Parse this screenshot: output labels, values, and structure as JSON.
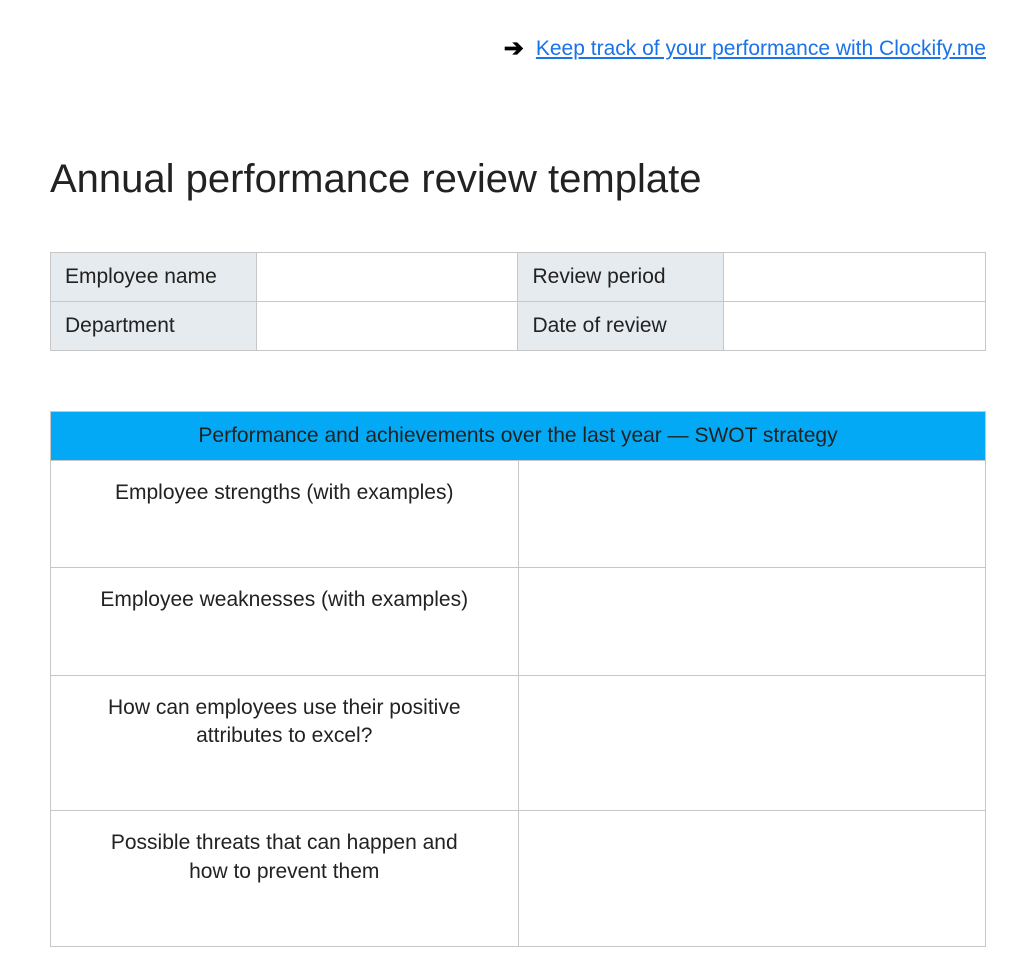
{
  "header": {
    "link_text": "Keep track of your performance with Clockify.me"
  },
  "title": "Annual performance review template",
  "info": {
    "rows": [
      {
        "label_left": "Employee name",
        "value_left": "",
        "label_right": "Review period",
        "value_right": ""
      },
      {
        "label_left": "Department",
        "value_left": "",
        "label_right": "Date of review",
        "value_right": ""
      }
    ]
  },
  "swot": {
    "header": "Performance and achievements over the last year — SWOT strategy",
    "rows": [
      {
        "label": "Employee strengths (with examples)",
        "value": ""
      },
      {
        "label": "Employee weaknesses (with examples)",
        "value": ""
      },
      {
        "label": "How can employees use their positive attributes to excel?",
        "value": ""
      },
      {
        "label": "Possible threats that can happen and how to prevent them",
        "value": ""
      }
    ]
  }
}
